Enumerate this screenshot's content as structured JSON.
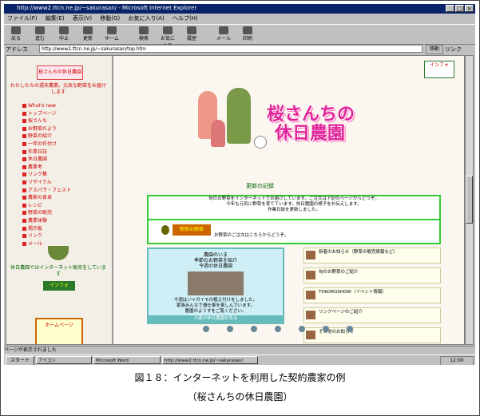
{
  "window": {
    "title": "http://www2.ttcn.ne.jp/~sakurasan/ - Microsoft Internet Explorer",
    "minimize": "_",
    "maximize": "□",
    "close": "×"
  },
  "menu": [
    "ファイル(F)",
    "編集(E)",
    "表示(V)",
    "移動(G)",
    "お気に入り(A)",
    "ヘルプ(H)"
  ],
  "toolbar": [
    "戻る",
    "進む",
    "中止",
    "更新",
    "ホーム",
    "検索",
    "お気に入り",
    "履歴",
    "メール",
    "印刷"
  ],
  "address": {
    "label": "アドレス",
    "value": "http://www2.ttcn.ne.jp/~sakurasan/top.htm",
    "go": "移動",
    "links": "リンク"
  },
  "left": {
    "logo": "桜さんちの休日農園",
    "intro": "わたしたちの週末農業。元気な野菜をお届けします",
    "menu": [
      "What's new",
      "トップページ",
      "桜さんち",
      "お野菜だより",
      "野菜の紹介",
      "一年の作付け",
      "作業日誌",
      "休日農園",
      "農業考",
      "リンク集",
      "リサイクル",
      "アスパラ・フェスト",
      "農家の食卓",
      "レシピ",
      "野菜の販売",
      "農業体験",
      "掲示板",
      "リンク",
      "メール"
    ],
    "note": "休日農園ではインターネット販売をしています",
    "button": "インフォ",
    "panel": "ホームページ"
  },
  "right": {
    "logo_tr": "インフォ",
    "title_l1": "桜さんちの",
    "title_l2": "休日農園",
    "update_title": "更新の記録",
    "update_lines": [
      "旬のお野菜をインターネットでお届けしています。ご注文は下記のページからどうぞ。",
      "今年も元気に野菜を育てています。休日農園の様子をお伝えします。",
      "作業日誌を更新しました。"
    ],
    "banner_label": "新鮮お野菜",
    "banner_text": "お野菜のご注文はこちらからどうぞ。",
    "center_title1": "農園のいま",
    "center_title2": "季節のお野菜を紹介",
    "center_title3": "今週の休日農園",
    "center_desc1": "今週はジャガイモの植え付けをしました。",
    "center_desc2": "家族みんなで畑仕事を楽しんでいます。",
    "center_desc3": "農園のようすをご覧ください。",
    "center_foot": "今週の休日農園を見る",
    "list": [
      "新着のお知らせ（野菜の販売情報など）",
      "旬のお野菜のご紹介",
      "TOKOROSHOW（イベント情報）",
      "リンクページのご紹介",
      "その他のお知らせ"
    ]
  },
  "status": "ページが表示されました",
  "taskbar": {
    "start": "スタート",
    "tasks": [
      "アイコン",
      "Microsoft Word",
      "http://www2.ttcn.ne.jp/~sakurasan/"
    ],
    "clock": "12:00"
  },
  "caption": {
    "line1": "図１８：インターネットを利用した契約農家の例",
    "line2": "（桜さんちの休日農園）"
  }
}
